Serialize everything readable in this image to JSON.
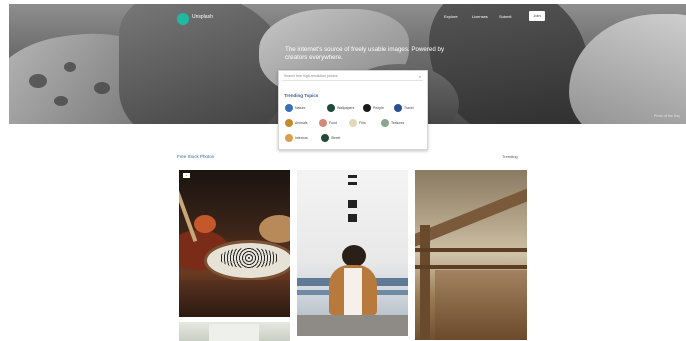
{
  "brand": {
    "logo_text": "Unsplash"
  },
  "nav": {
    "items": [
      "Explore",
      "Licenses",
      "Submit"
    ],
    "join_label": "Join"
  },
  "hero": {
    "headline": "The internet's source of freely usable images. Powered by creators everywhere.",
    "credit": "Photo of the Day"
  },
  "search": {
    "placeholder": "Search free high-resolution photos",
    "trending_title": "Trending Topics",
    "chips": [
      {
        "label": "Nature",
        "color": "#3b6fb5"
      },
      {
        "label": "Wallpapers",
        "color": "#1f4b3f"
      },
      {
        "label": "People",
        "color": "#1a1a1a"
      },
      {
        "label": "Travel",
        "color": "#2c4f8f"
      },
      {
        "label": "Animals",
        "color": "#c28a2a"
      },
      {
        "label": "Food",
        "color": "#d38a7a"
      },
      {
        "label": "Film",
        "color": "#e2d7b7"
      },
      {
        "label": "Textures",
        "color": "#8aa58e"
      },
      {
        "label": "Interiors",
        "color": "#d8a04a"
      },
      {
        "label": "Street",
        "color": "#234a34"
      }
    ]
  },
  "section": {
    "title": "Free Stock Photos",
    "link": "Trending"
  },
  "photos": [
    {
      "name": "food-photo",
      "badge": "+"
    },
    {
      "name": "person-photo"
    },
    {
      "name": "fence-photo"
    },
    {
      "name": "mountain-photo"
    }
  ]
}
